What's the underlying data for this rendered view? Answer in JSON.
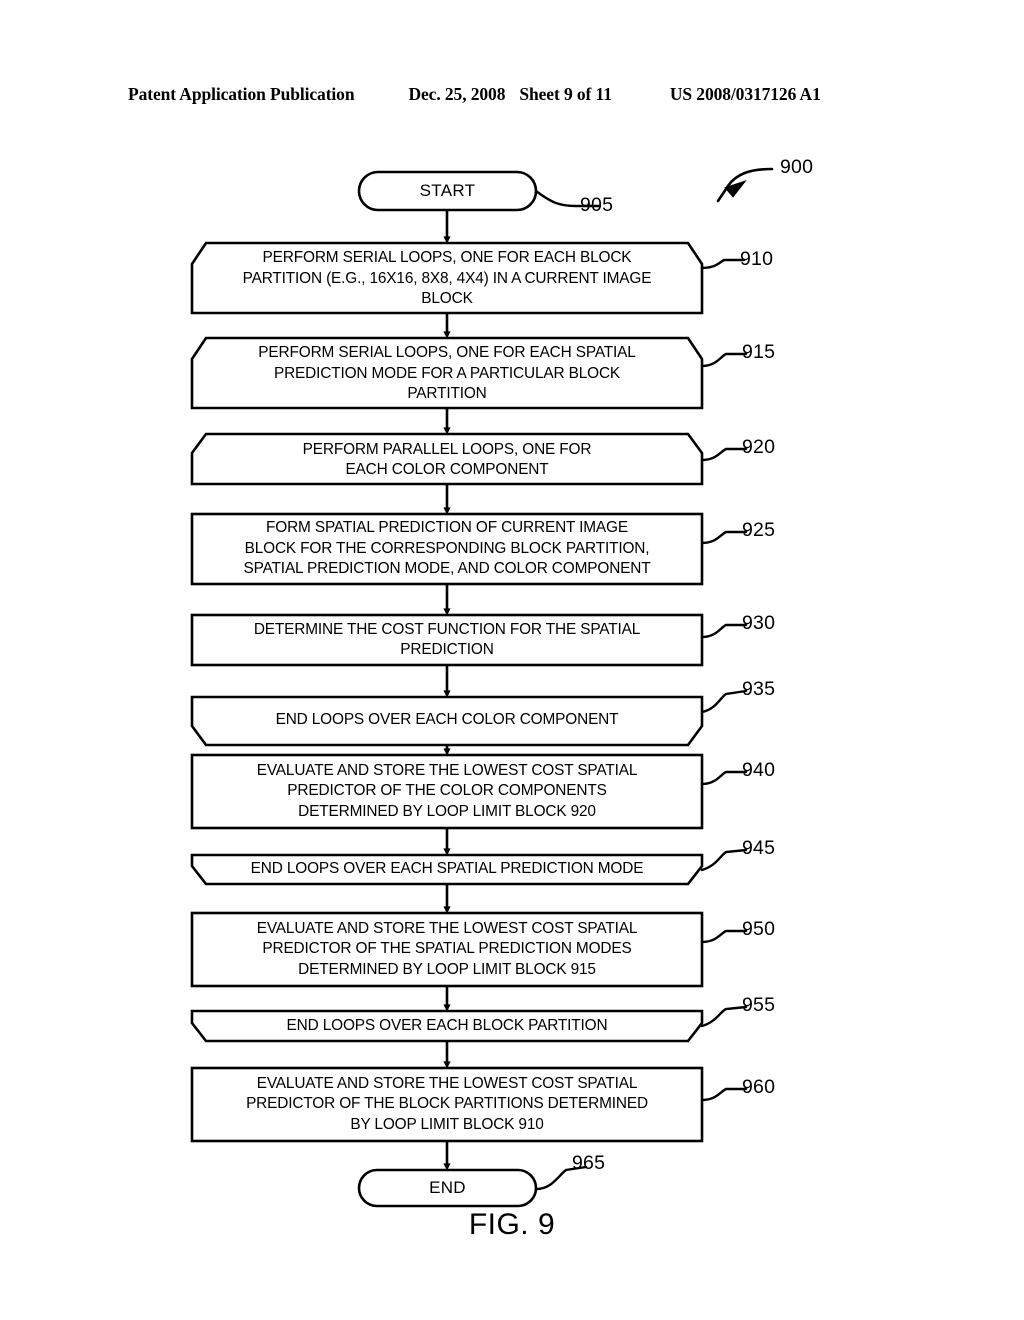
{
  "header": {
    "publication": "Patent Application Publication",
    "date": "Dec. 25, 2008",
    "sheet": "Sheet 9 of 11",
    "patent_number": "US 2008/0317126 A1"
  },
  "figure": {
    "caption": "FIG. 9",
    "diagram_ref": "900"
  },
  "nodes": [
    {
      "ref": "905",
      "shape": "terminal",
      "text": "START"
    },
    {
      "ref": "910",
      "shape": "loop-limit-start",
      "text": "PERFORM SERIAL LOOPS, ONE FOR EACH BLOCK\nPARTITION (E.G., 16X16, 8X8, 4X4) IN A CURRENT IMAGE\nBLOCK"
    },
    {
      "ref": "915",
      "shape": "loop-limit-start",
      "text": "PERFORM SERIAL LOOPS, ONE FOR EACH SPATIAL\nPREDICTION MODE FOR A PARTICULAR BLOCK\nPARTITION"
    },
    {
      "ref": "920",
      "shape": "loop-limit-start",
      "text": "PERFORM PARALLEL LOOPS, ONE FOR\nEACH  COLOR COMPONENT"
    },
    {
      "ref": "925",
      "shape": "process",
      "text": "FORM SPATIAL PREDICTION OF CURRENT IMAGE\nBLOCK FOR THE CORRESPONDING BLOCK PARTITION,\nSPATIAL PREDICTION MODE, AND COLOR COMPONENT"
    },
    {
      "ref": "930",
      "shape": "process",
      "text": "DETERMINE THE COST FUNCTION FOR THE SPATIAL\nPREDICTION"
    },
    {
      "ref": "935",
      "shape": "loop-limit-end",
      "text": "END LOOPS OVER EACH COLOR COMPONENT"
    },
    {
      "ref": "940",
      "shape": "process",
      "text": "EVALUATE AND STORE THE LOWEST COST SPATIAL\nPREDICTOR OF THE COLOR COMPONENTS\nDETERMINED BY LOOP LIMIT BLOCK 920"
    },
    {
      "ref": "945",
      "shape": "loop-limit-end",
      "text": "END LOOPS OVER EACH SPATIAL PREDICTION MODE"
    },
    {
      "ref": "950",
      "shape": "process",
      "text": "EVALUATE AND STORE THE LOWEST COST SPATIAL\nPREDICTOR OF THE SPATIAL PREDICTION MODES\nDETERMINED BY LOOP LIMIT BLOCK 915"
    },
    {
      "ref": "955",
      "shape": "loop-limit-end",
      "text": "END LOOPS OVER EACH BLOCK PARTITION"
    },
    {
      "ref": "960",
      "shape": "process",
      "text": "EVALUATE AND STORE THE LOWEST COST SPATIAL\nPREDICTOR OF THE BLOCK PARTITIONS DETERMINED\nBY LOOP LIMIT BLOCK 910"
    },
    {
      "ref": "965",
      "shape": "terminal",
      "text": "END"
    }
  ],
  "colors": {
    "ink": "#000000",
    "paper": "#ffffff"
  }
}
